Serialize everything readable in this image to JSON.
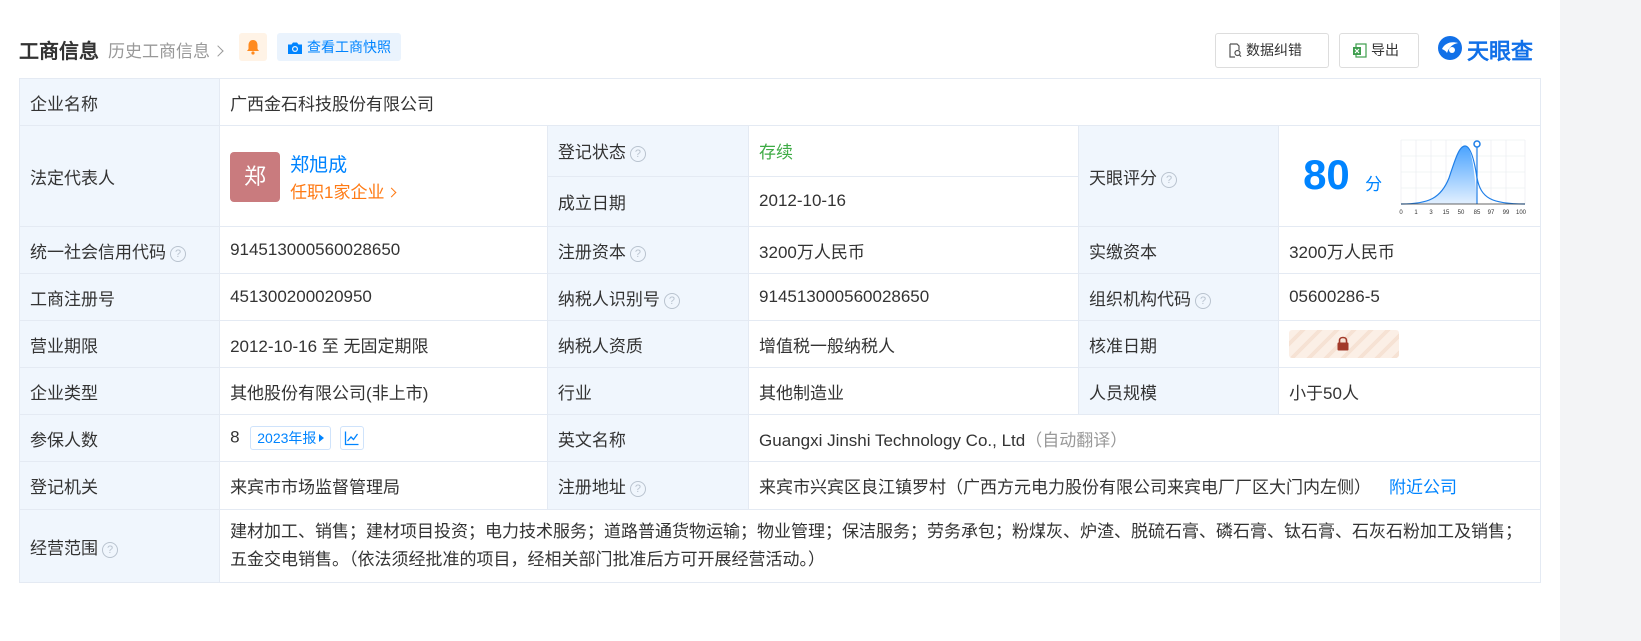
{
  "header": {
    "title": "工商信息",
    "history_link": "历史工商信息",
    "snapshot_button": "查看工商快照",
    "correct_button": "数据纠错",
    "export_button": "导出",
    "logo_text": "天眼查"
  },
  "icons": {
    "bell": "bell-icon",
    "camera": "camera-icon",
    "correct": "document-search-icon",
    "export": "excel-icon",
    "logo": "tianyancha-logo-icon",
    "help": "question-circle-icon",
    "lock": "lock-icon",
    "trend": "line-chart-icon"
  },
  "colors": {
    "accent": "#0084ff",
    "label_bg": "#f0f6fd",
    "status_green": "#3eab45",
    "role_orange": "#ff7a14",
    "avatar_bg": "#c97b7e"
  },
  "table": {
    "company_name": {
      "label": "企业名称",
      "value": "广西金石科技股份有限公司"
    },
    "legal_rep": {
      "label": "法定代表人",
      "avatar_char": "郑",
      "name": "郑旭成",
      "roles": "任职1家企业"
    },
    "reg_status": {
      "label": "登记状态",
      "value": "存续"
    },
    "founded": {
      "label": "成立日期",
      "value": "2012-10-16"
    },
    "score": {
      "label": "天眼评分",
      "value": "80",
      "unit": "分",
      "axis_ticks": [
        "0",
        "1",
        "3",
        "15",
        "50",
        "85",
        "97",
        "99",
        "100"
      ]
    },
    "credit_code": {
      "label": "统一社会信用代码",
      "value": "914513000560028650"
    },
    "reg_capital": {
      "label": "注册资本",
      "value": "3200万人民币"
    },
    "paid_capital": {
      "label": "实缴资本",
      "value": "3200万人民币"
    },
    "biz_reg_no": {
      "label": "工商注册号",
      "value": "451300200020950"
    },
    "taxpayer_id": {
      "label": "纳税人识别号",
      "value": "914513000560028650"
    },
    "org_code": {
      "label": "组织机构代码",
      "value": "05600286-5"
    },
    "biz_term": {
      "label": "营业期限",
      "value": "2012-10-16 至 无固定期限"
    },
    "taxpayer_qual": {
      "label": "纳税人资质",
      "value": "增值税一般纳税人"
    },
    "approval_date": {
      "label": "核准日期"
    },
    "company_type": {
      "label": "企业类型",
      "value": "其他股份有限公司(非上市)"
    },
    "industry": {
      "label": "行业",
      "value": "其他制造业"
    },
    "staff_size": {
      "label": "人员规模",
      "value": "小于50人"
    },
    "insured": {
      "label": "参保人数",
      "value": "8",
      "report_button": "2023年报"
    },
    "english_name": {
      "label": "英文名称",
      "value": "Guangxi Jinshi Technology Co., Ltd",
      "note": "（自动翻译）"
    },
    "reg_authority": {
      "label": "登记机关",
      "value": "来宾市市场监督管理局"
    },
    "reg_address": {
      "label": "注册地址",
      "value": "来宾市兴宾区良江镇罗村（广西方元电力股份有限公司来宾电厂厂区大门内左侧）",
      "nearby": "附近公司"
    },
    "biz_scope": {
      "label": "经营范围",
      "value": "建材加工、销售；建材项目投资；电力技术服务；道路普通货物运输；物业管理；保洁服务；劳务承包；粉煤灰、炉渣、脱硫石膏、磷石膏、钛石膏、石灰石粉加工及销售；五金交电销售。（依法须经批准的项目，经相关部门批准后方可开展经营活动。）"
    }
  }
}
